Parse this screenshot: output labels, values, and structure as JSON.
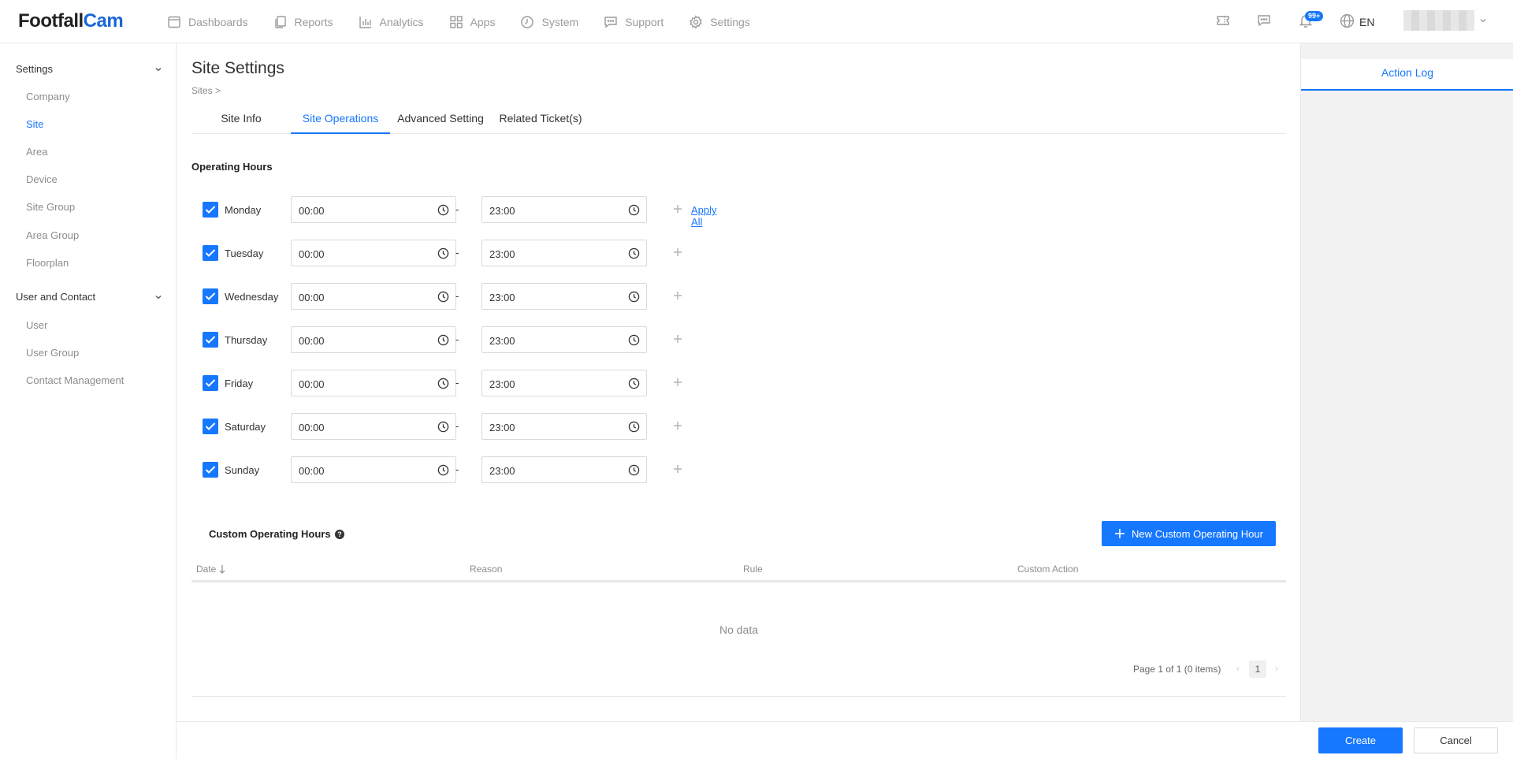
{
  "logo": {
    "part1": "Footfall",
    "part2": "Cam"
  },
  "nav": {
    "items": [
      {
        "label": "Dashboards",
        "icon": "dashboard-icon"
      },
      {
        "label": "Reports",
        "icon": "reports-icon"
      },
      {
        "label": "Analytics",
        "icon": "analytics-icon"
      },
      {
        "label": "Apps",
        "icon": "apps-icon"
      },
      {
        "label": "System",
        "icon": "system-icon"
      },
      {
        "label": "Support",
        "icon": "support-icon"
      },
      {
        "label": "Settings",
        "icon": "settings-icon"
      }
    ],
    "notification_badge": "99+",
    "language": "EN"
  },
  "sidebar": {
    "groups": [
      {
        "label": "Settings",
        "items": [
          "Company",
          "Site",
          "Area",
          "Device",
          "Site Group",
          "Area Group",
          "Floorplan"
        ]
      },
      {
        "label": "User and Contact",
        "items": [
          "User",
          "User Group",
          "Contact Management"
        ]
      }
    ],
    "active_item": "Site"
  },
  "page": {
    "title": "Site Settings",
    "breadcrumb": "Sites >",
    "tabs": [
      "Site Info",
      "Site Operations",
      "Advanced Setting",
      "Related Ticket(s)"
    ],
    "active_tab": "Site Operations"
  },
  "operating_hours": {
    "title": "Operating Hours",
    "separator": "-",
    "apply_all": "Apply All",
    "days": [
      {
        "day": "Monday",
        "checked": true,
        "start": "00:00",
        "end": "23:00"
      },
      {
        "day": "Tuesday",
        "checked": true,
        "start": "00:00",
        "end": "23:00"
      },
      {
        "day": "Wednesday",
        "checked": true,
        "start": "00:00",
        "end": "23:00"
      },
      {
        "day": "Thursday",
        "checked": true,
        "start": "00:00",
        "end": "23:00"
      },
      {
        "day": "Friday",
        "checked": true,
        "start": "00:00",
        "end": "23:00"
      },
      {
        "day": "Saturday",
        "checked": true,
        "start": "00:00",
        "end": "23:00"
      },
      {
        "day": "Sunday",
        "checked": true,
        "start": "00:00",
        "end": "23:00"
      }
    ]
  },
  "custom_hours": {
    "title": "Custom Operating Hours",
    "new_button": "New Custom Operating Hour",
    "columns": [
      "Date",
      "Reason",
      "Rule",
      "Custom Action"
    ],
    "empty_text": "No data",
    "pagination": {
      "summary": "Page 1 of 1 (0 items)",
      "current_page": "1"
    }
  },
  "right_panel": {
    "title": "Action Log"
  },
  "footer": {
    "create": "Create",
    "cancel": "Cancel"
  },
  "colors": {
    "accent": "#1677ff",
    "logo_blue": "#1a66d9"
  }
}
